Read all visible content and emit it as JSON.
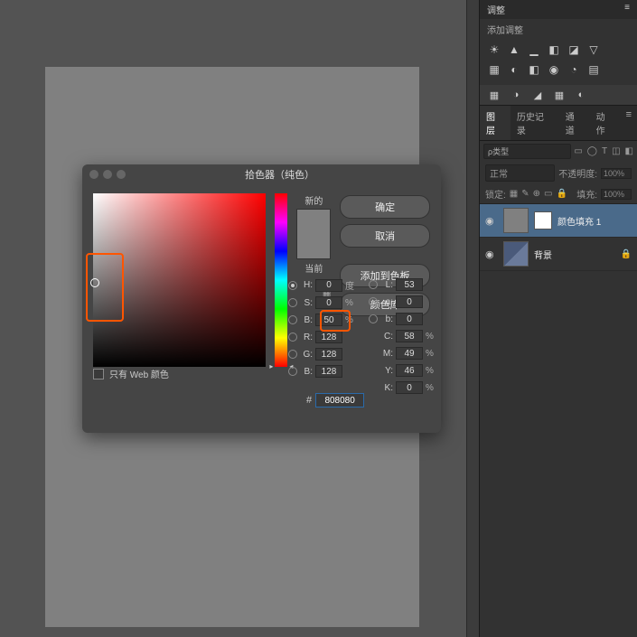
{
  "adjustments": {
    "header": "调整",
    "title": "添加调整",
    "row1": [
      "☀",
      "▲",
      "▁",
      "◧",
      "◪",
      "▽"
    ],
    "row2": [
      "▦",
      "◐",
      "◧",
      "◉",
      "◔",
      "▤"
    ],
    "bottom": [
      "▦",
      "◑",
      "◢",
      "▦",
      "◐"
    ]
  },
  "layers": {
    "tabs": [
      "图层",
      "历史记录",
      "通道",
      "动作"
    ],
    "menu_icon": "≡",
    "search_label": "类型",
    "search_icons": [
      "▭",
      "◯",
      "T",
      "◫",
      "◧"
    ],
    "blend_mode": "正常",
    "opacity_label": "不透明度:",
    "opacity_value": "100%",
    "lock_label": "锁定:",
    "lock_icons": [
      "▦",
      "✎",
      "⊕",
      "▭",
      "🔒"
    ],
    "fill_label": "填充:",
    "fill_value": "100%",
    "items": [
      {
        "name": "颜色填充 1",
        "locked": false,
        "selected": true,
        "has_mask": true
      },
      {
        "name": "背景",
        "locked": true,
        "selected": false,
        "has_mask": false
      }
    ]
  },
  "picker": {
    "title": "拾色器（纯色）",
    "new_label": "新的",
    "current_label": "当前",
    "buttons": {
      "ok": "确定",
      "cancel": "取消",
      "add_swatch": "添加到色板",
      "color_libs": "颜色库"
    },
    "hsb": {
      "h": {
        "label": "H:",
        "value": "0",
        "unit": "度"
      },
      "s": {
        "label": "S:",
        "value": "0",
        "unit": "%"
      },
      "b": {
        "label": "B:",
        "value": "50",
        "unit": "%"
      }
    },
    "rgb": {
      "r": {
        "label": "R:",
        "value": "128"
      },
      "g": {
        "label": "G:",
        "value": "128"
      },
      "b": {
        "label": "B:",
        "value": "128"
      }
    },
    "lab": {
      "l": {
        "label": "L:",
        "value": "53"
      },
      "a": {
        "label": "a:",
        "value": "0"
      },
      "b": {
        "label": "b:",
        "value": "0"
      }
    },
    "cmyk": {
      "c": {
        "label": "C:",
        "value": "58",
        "unit": "%"
      },
      "m": {
        "label": "M:",
        "value": "49",
        "unit": "%"
      },
      "y": {
        "label": "Y:",
        "value": "46",
        "unit": "%"
      },
      "k": {
        "label": "K:",
        "value": "0",
        "unit": "%"
      }
    },
    "hex_prefix": "#",
    "hex": "808080",
    "web_only": "只有 Web 颜色"
  }
}
